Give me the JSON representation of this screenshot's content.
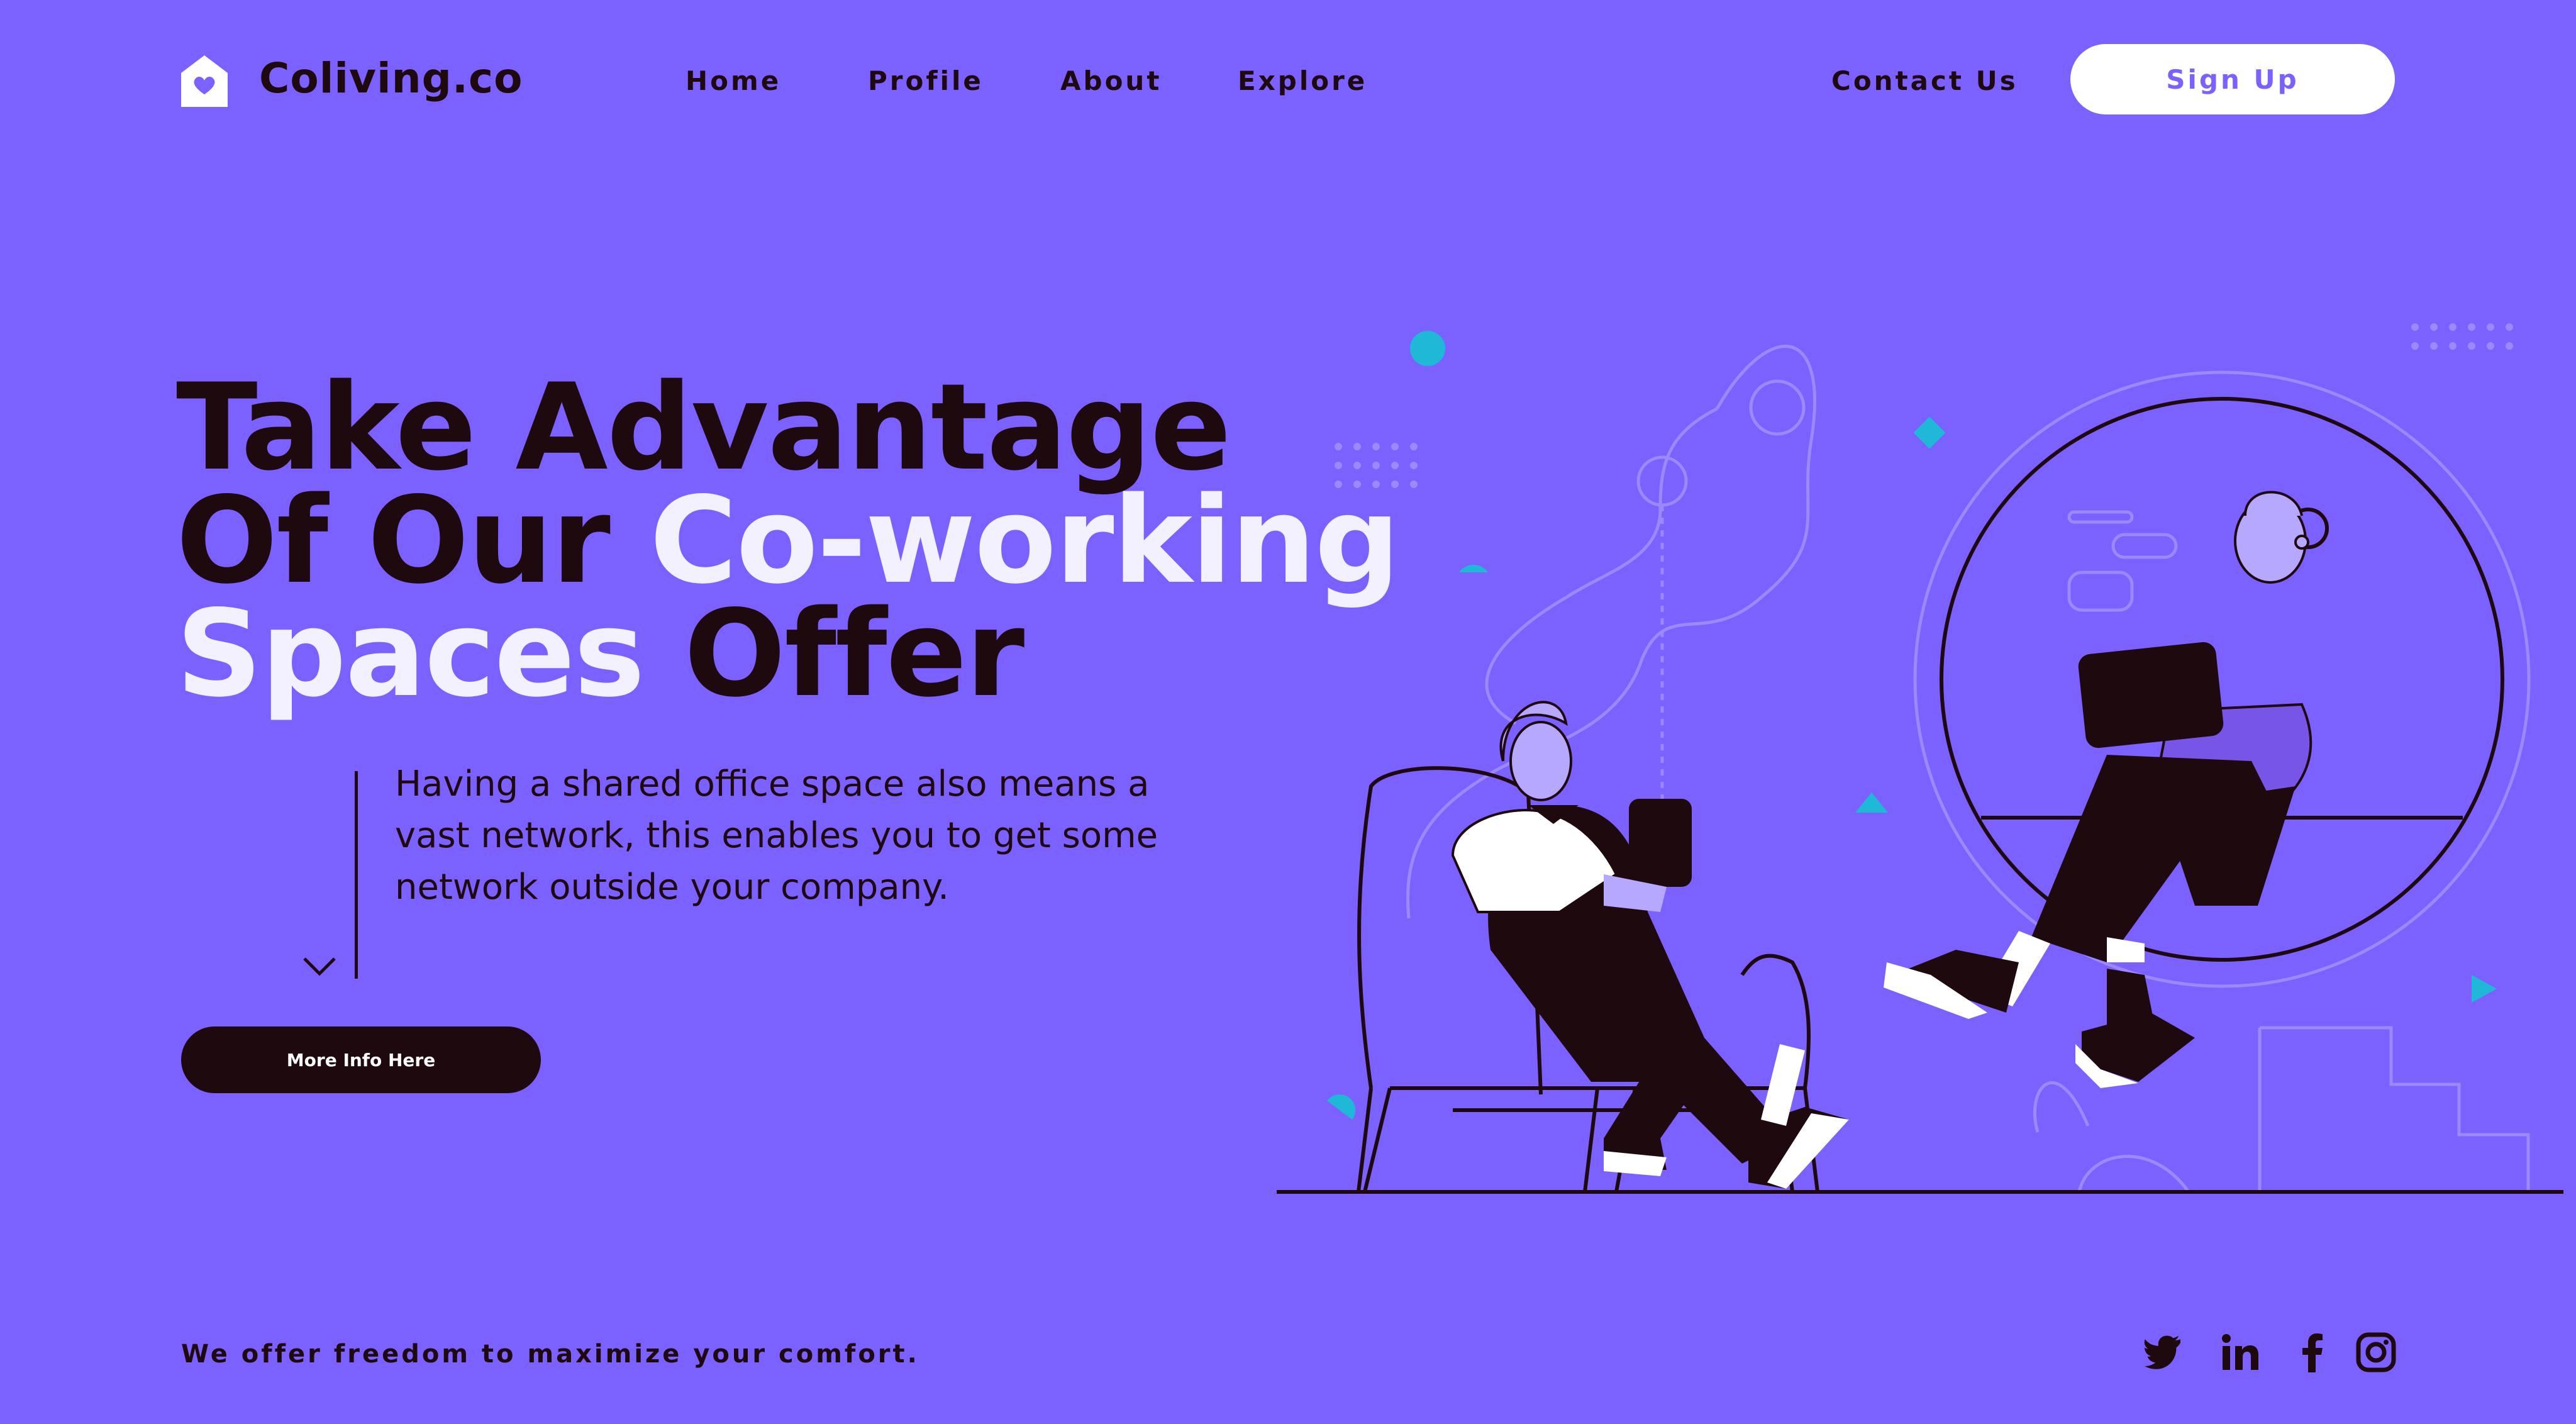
{
  "brand": {
    "name": "Coliving.co",
    "icon": "home-heart-icon"
  },
  "nav": {
    "items": [
      "Home",
      "Profile",
      "About",
      "Explore"
    ],
    "contact": "Contact Us",
    "signup": "Sign Up"
  },
  "hero": {
    "title_line1": "Take Advantage",
    "title_line2_dark": "Of Our ",
    "title_line2_light": "Co-working",
    "title_line3_light": "Spaces ",
    "title_line3_dark": "Offer",
    "description": "Having a shared office space also means a vast network, this enables you to get some network outside your company.",
    "cta": "More Info Here"
  },
  "footer": {
    "tagline": "We offer freedom to maximize your comfort.",
    "social": [
      "twitter-icon",
      "linkedin-icon",
      "facebook-icon",
      "instagram-icon"
    ]
  },
  "colors": {
    "background": "#7B61FF",
    "dark": "#1E0A0E",
    "light": "#F3F0FF",
    "accent": "#1FB8D6",
    "lavender": "#B7A8FF"
  }
}
